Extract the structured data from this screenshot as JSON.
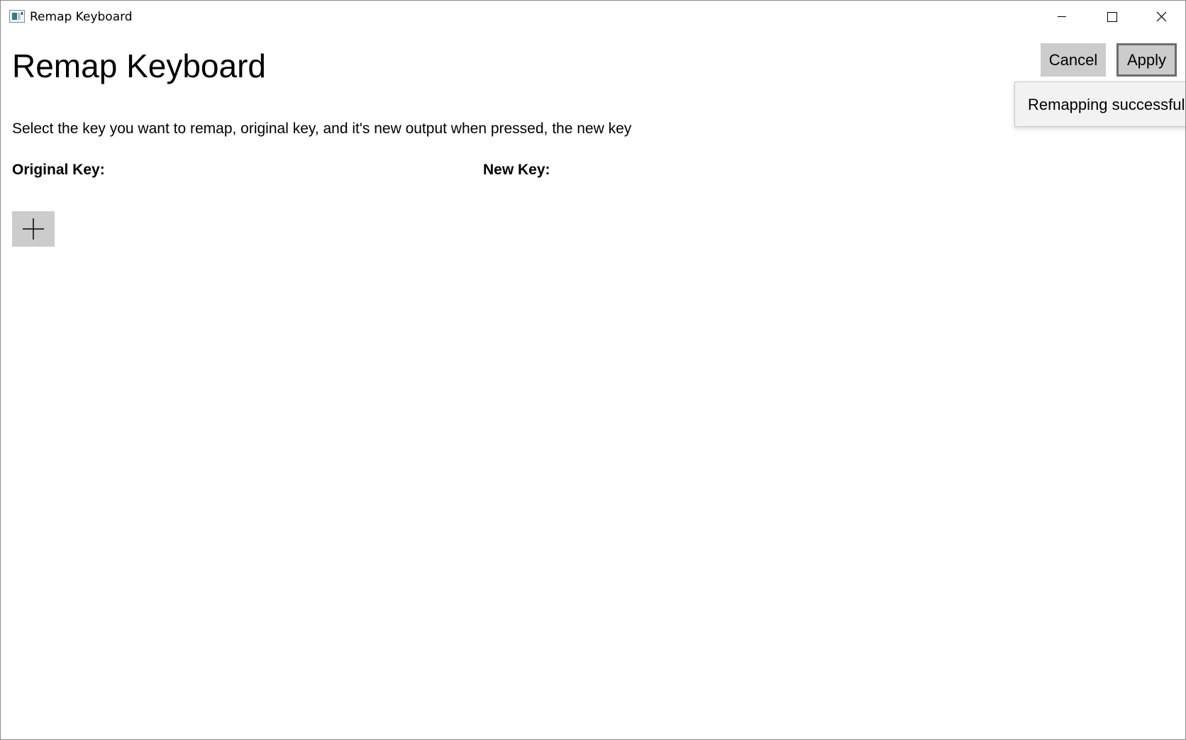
{
  "window": {
    "title": "Remap Keyboard",
    "controls": [
      "minimize-icon",
      "maximize-icon",
      "close-icon"
    ]
  },
  "page": {
    "title": "Remap Keyboard",
    "instructions": "Select the key you want to remap, original key, and it's new output when pressed, the new key",
    "columns": {
      "original": "Original Key:",
      "new": "New Key:"
    }
  },
  "actions": {
    "cancel_label": "Cancel",
    "apply_label": "Apply"
  },
  "toast": {
    "message": "Remapping successful"
  },
  "add_button": {
    "icon": "plus-icon"
  },
  "colors": {
    "button_bg": "#cccccc",
    "apply_border": "#6d6d6d",
    "toast_bg": "#f2f2f2"
  }
}
